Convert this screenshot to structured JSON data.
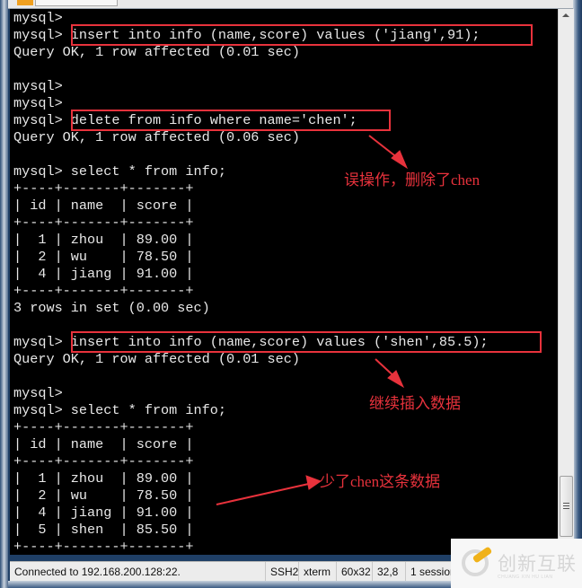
{
  "window": {
    "tab_label": "",
    "terminal_lines": [
      "mysql>",
      "mysql> insert into info (name,score) values ('jiang',91);",
      "Query OK, 1 row affected (0.01 sec)",
      "",
      "mysql>",
      "mysql>",
      "mysql> delete from info where name='chen';",
      "Query OK, 1 row affected (0.06 sec)",
      "",
      "mysql> select * from info;",
      "+----+-------+-------+",
      "| id | name  | score |",
      "+----+-------+-------+",
      "|  1 | zhou  | 89.00 |",
      "|  2 | wu    | 78.50 |",
      "|  4 | jiang | 91.00 |",
      "+----+-------+-------+",
      "3 rows in set (0.00 sec)",
      "",
      "mysql> insert into info (name,score) values ('shen',85.5);",
      "Query OK, 1 row affected (0.01 sec)",
      "",
      "mysql>",
      "mysql> select * from info;",
      "+----+-------+-------+",
      "| id | name  | score |",
      "+----+-------+-------+",
      "|  1 | zhou  | 89.00 |",
      "|  2 | wu    | 78.50 |",
      "|  4 | jiang | 91.00 |",
      "|  5 | shen  | 85.50 |",
      "+----+-------+-------+"
    ]
  },
  "annotations": {
    "delete_note": "误操作，删除了chen",
    "insert_note": "继续插入数据",
    "missing_note": "少了chen这条数据",
    "color": "#e8323c"
  },
  "statusbar": {
    "connection": "Connected to 192.168.200.128:22.",
    "protocol": "SSH2",
    "terminal_type": "xterm",
    "size": "60x32",
    "cursor": "32,8",
    "sessions": "1 sessions"
  },
  "watermark": {
    "brand": "创新互联",
    "sub": "CHUANG XIN HU LIAN"
  }
}
